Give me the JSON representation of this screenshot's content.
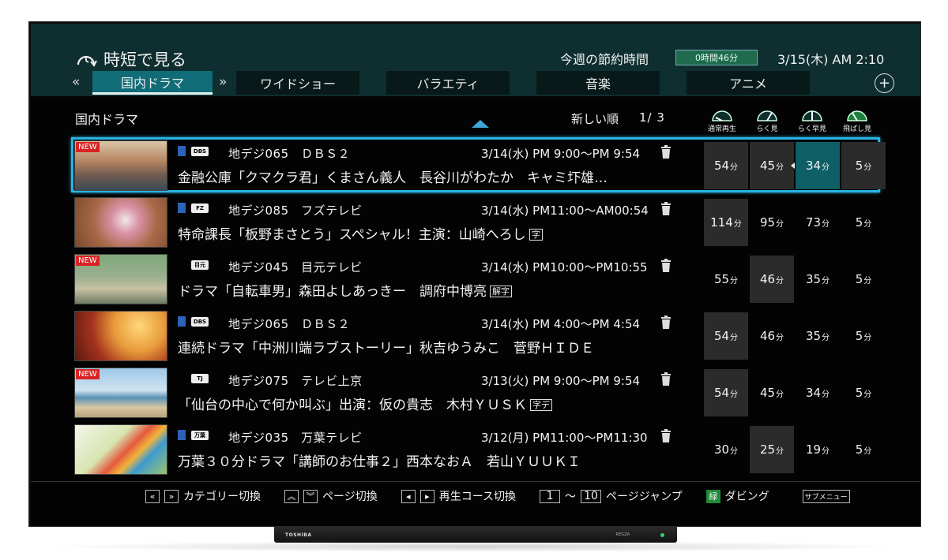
{
  "header": {
    "title": "時短で見る",
    "savings_label": "今週の節約時間",
    "savings_value": "0時間46分",
    "clock": "3/15(木) AM 2:10"
  },
  "tabs": [
    {
      "label": "国内ドラマ",
      "active": true
    },
    {
      "label": "ワイドショー"
    },
    {
      "label": "バラエティ"
    },
    {
      "label": "音楽"
    },
    {
      "label": "アニメ"
    }
  ],
  "nav": {
    "prev": "«",
    "next": "»",
    "add": "+"
  },
  "list_header": {
    "category": "国内ドラマ",
    "sort": "新しい順",
    "page": "1/ 3"
  },
  "modes": [
    "通常再生",
    "らく見",
    "らく早見",
    "飛ばし見"
  ],
  "programs": [
    {
      "new": true,
      "channel": "地デジ065　ＤＢＳ２",
      "net": "DBS",
      "time": "3/14(水) PM 9:00〜PM 9:54",
      "title": "金融公庫「クマクラ君」くまさん義人　長谷川がわたか　キャミ圷雄…",
      "tags": [],
      "durations": [
        "54",
        "45",
        "34",
        "5"
      ]
    },
    {
      "new": false,
      "channel": "地デジ085　フズテレビ",
      "net": "FZ",
      "time": "3/14(水) PM11:00〜AM00:54",
      "title": "特命課長「板野まさとう」スペシャル！主演：山崎へろし",
      "tags": [
        "字"
      ],
      "durations": [
        "114",
        "95",
        "73",
        "5"
      ]
    },
    {
      "new": true,
      "channel": "地デジ045　目元テレビ",
      "net": "目元",
      "time": "3/14(水) PM10:00〜PM10:55",
      "title": "ドラマ「自転車男」森田よしあっきー　調府中博亮",
      "tags": [
        "解字"
      ],
      "durations": [
        "55",
        "46",
        "35",
        "5"
      ]
    },
    {
      "new": false,
      "channel": "地デジ065　ＤＢＳ２",
      "net": "DBS",
      "time": "3/14(水) PM 4:00〜PM 4:54",
      "title": "連続ドラマ「中洲川端ラブストーリー」秋吉ゆうみこ　菅野ＨＩＤＥ",
      "tags": [],
      "durations": [
        "54",
        "46",
        "35",
        "5"
      ]
    },
    {
      "new": true,
      "channel": "地デジ075　テレビ上京",
      "net": "TJ",
      "time": "3/13(火) PM 9:00〜PM 9:54",
      "title": "「仙台の中心で何か叫ぶ」出演：仮の貴志　木村ＹＵＳＫ",
      "tags": [
        "字デ"
      ],
      "durations": [
        "54",
        "45",
        "34",
        "5"
      ]
    },
    {
      "new": false,
      "channel": "地デジ035　万葉テレビ",
      "net": "万葉",
      "time": "3/12(月) PM11:00〜PM11:30",
      "title": "万葉３０分ドラマ「講師のお仕事２」西本なおＡ　若山ＹＵＵＫＩ",
      "tags": [],
      "durations": [
        "30",
        "25",
        "19",
        "5"
      ]
    }
  ],
  "unit": "分",
  "new_label": "NEW",
  "footer": {
    "category_keys": [
      "«",
      "»"
    ],
    "category": "カテゴリー切換",
    "page_keys": [
      "︽",
      "︾"
    ],
    "page": "ページ切換",
    "course_keys": [
      "◂",
      "▸"
    ],
    "course": "再生コース切換",
    "jump_from": "1",
    "jump_sep": "〜",
    "jump_to": "10",
    "jump": "ページジャンプ",
    "green_key": "緑",
    "dubbing": "ダビング",
    "submenu": "サブメニュー"
  },
  "stand": {
    "brand": "TOSHIBA",
    "model": "REGZA"
  }
}
